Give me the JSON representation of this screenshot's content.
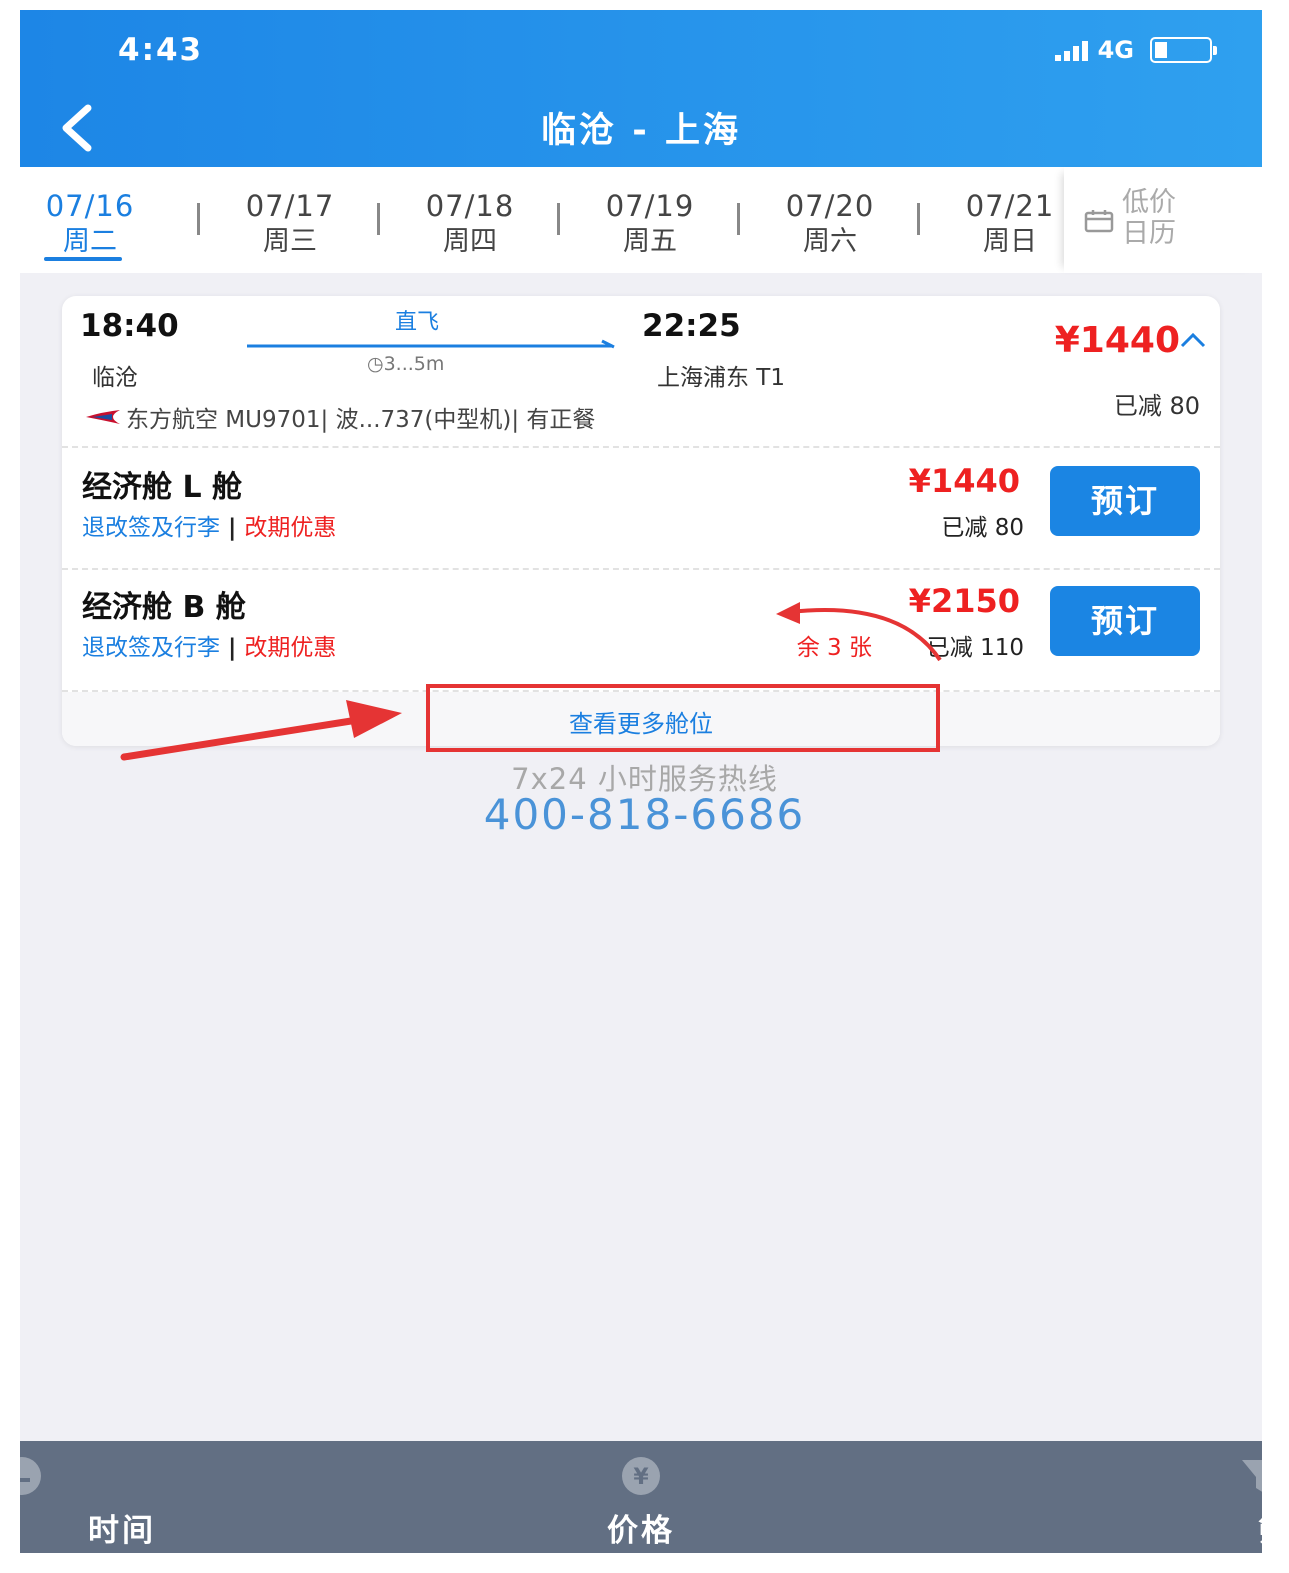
{
  "status_bar": {
    "time": "4:43",
    "network": "4G"
  },
  "header": {
    "title": "临沧 - 上海"
  },
  "date_tabs": [
    {
      "date": "07/16",
      "weekday": "周二",
      "active": true
    },
    {
      "date": "07/17",
      "weekday": "周三",
      "active": false
    },
    {
      "date": "07/18",
      "weekday": "周四",
      "active": false
    },
    {
      "date": "07/19",
      "weekday": "周五",
      "active": false
    },
    {
      "date": "07/20",
      "weekday": "周六",
      "active": false
    },
    {
      "date": "07/21",
      "weekday": "周日",
      "active": false
    }
  ],
  "calendar": {
    "label_line1": "低价",
    "label_line2": "日历"
  },
  "flight": {
    "dep_time": "18:40",
    "arr_time": "22:25",
    "type": "直飞",
    "duration": "3...5m",
    "dep_city": "临沧",
    "arr_airport": "上海浦东 T1",
    "info": "东方航空 MU9701| 波...737(中型机)| 有正餐",
    "price": "¥1440",
    "discount": "已减 80"
  },
  "cabins": [
    {
      "name": "经济舱 L 舱",
      "link1": "退改签及行李",
      "link2": "改期优惠",
      "price": "¥1440",
      "discount": "已减 80",
      "remaining": "",
      "book": "预订"
    },
    {
      "name": "经济舱 B 舱",
      "link1": "退改签及行李",
      "link2": "改期优惠",
      "price": "¥2150",
      "discount": "已减 110",
      "remaining": "余 3 张",
      "book": "预订"
    }
  ],
  "more_cabins": "查看更多舱位",
  "hotline": {
    "label": "7x24 小时服务热线",
    "number": "400-818-6686"
  },
  "bottom_bar": {
    "time": "时间",
    "price": "价格",
    "filter": "筛选"
  },
  "colors": {
    "primary": "#1b7fe0",
    "price_red": "#ee2121",
    "bottom_bar": "#626f83",
    "annotation": "#e53434"
  }
}
